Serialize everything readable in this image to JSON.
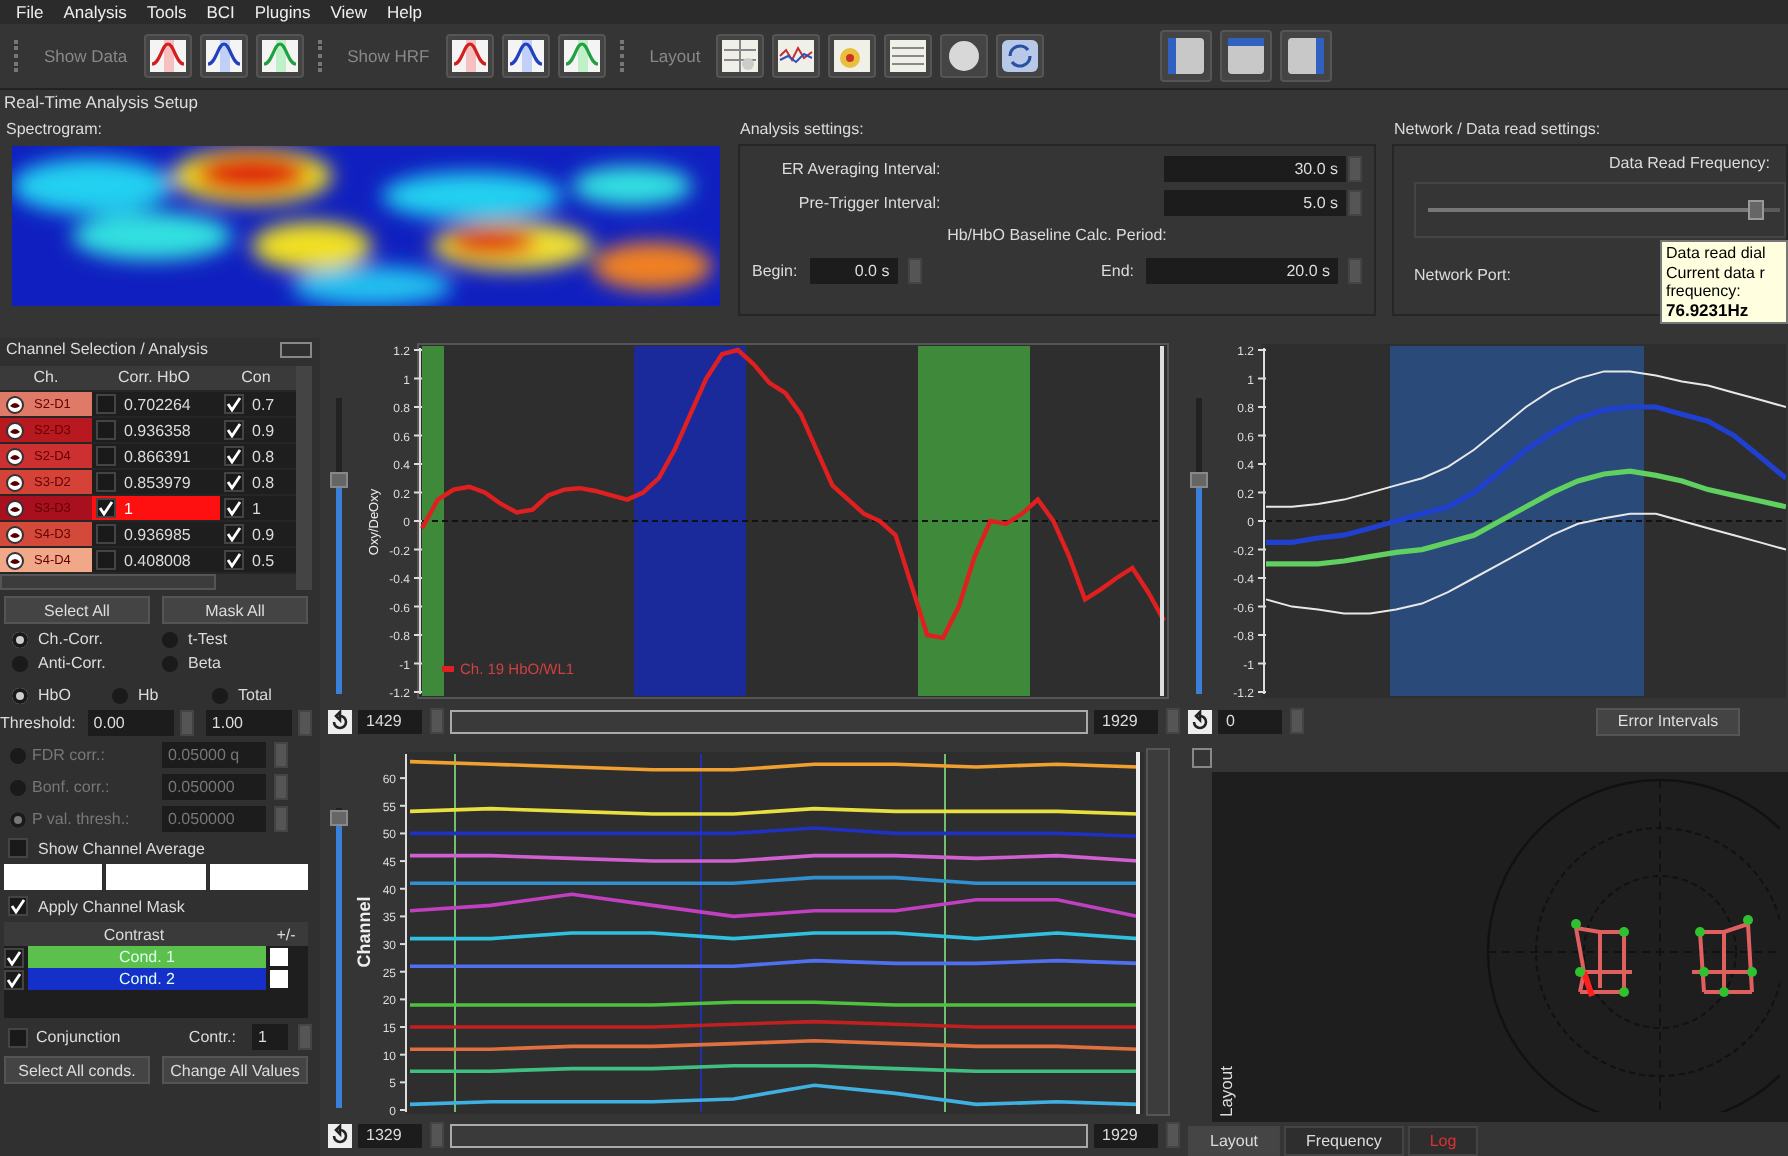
{
  "menu": [
    "File",
    "Analysis",
    "Tools",
    "BCI",
    "Plugins",
    "View",
    "Help"
  ],
  "toolbar": {
    "groups": [
      {
        "label": "Show Data"
      },
      {
        "label": "Show HRF"
      },
      {
        "label": "Layout"
      }
    ]
  },
  "title": "Real-Time Analysis Setup",
  "spectrogram": {
    "title": "Spectrogram:"
  },
  "analysis_settings": {
    "title": "Analysis settings:",
    "er_averaging": {
      "label": "ER Averaging Interval:",
      "value": "30.0 s"
    },
    "pre_trigger": {
      "label": "Pre-Trigger Interval:",
      "value": "5.0 s"
    },
    "baseline_title": "Hb/HbO Baseline Calc. Period:",
    "begin": {
      "label": "Begin:",
      "value": "0.0 s"
    },
    "end": {
      "label": "End:",
      "value": "20.0 s"
    }
  },
  "network": {
    "title": "Network / Data read settings:",
    "frequency_label": "Data Read Frequency:",
    "frequency_slider": {
      "level": 0.93
    },
    "port_label": "Network Port:",
    "tooltip": {
      "lines": [
        "Data read dial",
        "Current data r",
        "frequency:"
      ],
      "value": "76.9231Hz"
    }
  },
  "channel_panel": {
    "title": "Channel Selection / Analysis",
    "columns": [
      "Ch.",
      "Corr. HbO",
      "Con"
    ],
    "rows": [
      {
        "channel": "S2-D1",
        "color": "#e07a68",
        "checked": false,
        "corr": "0.702264",
        "con_checked": true,
        "con": "0.7",
        "selected": false
      },
      {
        "channel": "S2-D3",
        "color": "#b81820",
        "checked": false,
        "corr": "0.936358",
        "con_checked": true,
        "con": "0.9",
        "selected": false
      },
      {
        "channel": "S2-D4",
        "color": "#cc3030",
        "checked": false,
        "corr": "0.866391",
        "con_checked": true,
        "con": "0.8",
        "selected": false
      },
      {
        "channel": "S3-D2",
        "color": "#d44238",
        "checked": false,
        "corr": "0.853979",
        "con_checked": true,
        "con": "0.8",
        "selected": false
      },
      {
        "channel": "S3-D3",
        "color": "#a81020",
        "checked": true,
        "corr": "1",
        "con_checked": true,
        "con": "1",
        "selected": true
      },
      {
        "channel": "S4-D3",
        "color": "#d44a3a",
        "checked": false,
        "corr": "0.936985",
        "con_checked": true,
        "con": "0.9",
        "selected": false
      },
      {
        "channel": "S4-D4",
        "color": "#f0a888",
        "checked": false,
        "corr": "0.408008",
        "con_checked": true,
        "con": "0.5",
        "selected": false
      }
    ],
    "buttons": [
      "Select All",
      "Mask All"
    ],
    "method_options": [
      {
        "label": "Ch.-Corr.",
        "selected": true
      },
      {
        "label": "t-Test",
        "selected": false
      },
      {
        "label": "Anti-Corr.",
        "selected": false
      },
      {
        "label": "Beta",
        "selected": false
      }
    ],
    "signal_options": [
      {
        "label": "HbO",
        "selected": true
      },
      {
        "label": "Hb",
        "selected": false
      },
      {
        "label": "Total",
        "selected": false
      }
    ],
    "threshold": {
      "label": "Threshold:",
      "min": "0.00",
      "max": "1.00"
    },
    "corrections": [
      {
        "label": "FDR corr.:",
        "value": "0.05000 q",
        "selected": false,
        "disabled": true
      },
      {
        "label": "Bonf. corr.:",
        "value": "0.050000",
        "selected": false,
        "disabled": true
      },
      {
        "label": "P val. thresh.:",
        "value": "0.050000",
        "selected": true,
        "disabled": true
      }
    ],
    "show_channel_average": {
      "label": "Show Channel Average",
      "checked": false
    },
    "apply_channel_mask": {
      "label": "Apply Channel Mask",
      "checked": true
    },
    "contrast_table": {
      "columns": [
        "Contrast",
        "+/-"
      ],
      "rows": [
        {
          "label": "Cond. 1",
          "color": "#5cc04c",
          "checked": true
        },
        {
          "label": "Cond. 2",
          "color": "#1530c8",
          "checked": true
        }
      ]
    },
    "conjunction": {
      "label": "Conjunction",
      "checked": false
    },
    "contrast_spin": {
      "label": "Contr.:",
      "value": "1"
    },
    "bottom_buttons": [
      "Select All conds.",
      "Change All Values"
    ]
  },
  "signal_chart": {
    "slider": {
      "level": 0.72
    },
    "range_start": "1429",
    "range_end": "1929",
    "chart_data": {
      "type": "line",
      "ylabel": "Oxy/DeOxy",
      "ylim": [
        -1.2,
        1.2
      ],
      "yticks": [
        -1.2,
        -1,
        -0.8,
        -0.6,
        -0.4,
        -0.2,
        0,
        0.2,
        0.4,
        0.6,
        0.8,
        1,
        1.2
      ],
      "series": [
        {
          "name": "Ch. 19 HbO/WL1",
          "color": "#e02020",
          "values": [
            -0.05,
            0.15,
            0.22,
            0.24,
            0.2,
            0.12,
            0.06,
            0.08,
            0.18,
            0.22,
            0.23,
            0.21,
            0.18,
            0.15,
            0.2,
            0.3,
            0.5,
            0.75,
            1.0,
            1.17,
            1.2,
            1.1,
            0.97,
            0.9,
            0.75,
            0.5,
            0.25,
            0.15,
            0.05,
            0.0,
            -0.1,
            -0.45,
            -0.8,
            -0.82,
            -0.6,
            -0.25,
            0.0,
            -0.02,
            0.05,
            0.15,
            0.0,
            -0.25,
            -0.55,
            -0.48,
            -0.4,
            -0.33,
            -0.5,
            -0.7
          ]
        }
      ],
      "ref_lines": [
        {
          "axis": "y",
          "value": 0
        }
      ]
    }
  },
  "hrf_chart": {
    "slider": {
      "level": 0.72
    },
    "range_start": "0",
    "button": "Error Intervals",
    "chart_data": {
      "type": "line",
      "ylim": [
        -1.2,
        1.2
      ],
      "yticks": [
        -1.2,
        -1,
        -0.8,
        -0.6,
        -0.4,
        -0.2,
        0,
        0.2,
        0.4,
        0.6,
        0.8,
        1,
        1.2
      ],
      "series": [
        {
          "color": "#2040d0",
          "values": [
            -0.15,
            -0.15,
            -0.12,
            -0.1,
            -0.05,
            0.0,
            0.05,
            0.1,
            0.2,
            0.35,
            0.5,
            0.62,
            0.72,
            0.78,
            0.8,
            0.8,
            0.75,
            0.7,
            0.6,
            0.45,
            0.3
          ]
        },
        {
          "color": "#60d060",
          "values": [
            -0.3,
            -0.3,
            -0.3,
            -0.28,
            -0.25,
            -0.22,
            -0.2,
            -0.15,
            -0.1,
            0.0,
            0.1,
            0.2,
            0.28,
            0.33,
            0.35,
            0.32,
            0.28,
            0.22,
            0.18,
            0.14,
            0.1
          ]
        },
        {
          "color": "#e8e8e8",
          "values": [
            0.1,
            0.1,
            0.12,
            0.15,
            0.2,
            0.25,
            0.3,
            0.38,
            0.5,
            0.65,
            0.8,
            0.92,
            1.0,
            1.05,
            1.05,
            1.02,
            0.98,
            0.95,
            0.9,
            0.85,
            0.8
          ]
        },
        {
          "color": "#e8e8e8",
          "values": [
            -0.55,
            -0.6,
            -0.62,
            -0.65,
            -0.65,
            -0.62,
            -0.58,
            -0.5,
            -0.4,
            -0.3,
            -0.2,
            -0.1,
            -0.02,
            0.02,
            0.05,
            0.05,
            0.0,
            -0.05,
            -0.1,
            -0.15,
            -0.2
          ]
        }
      ],
      "ref_lines": [
        {
          "axis": "y",
          "value": 0
        }
      ]
    }
  },
  "channel_chart": {
    "slider": {
      "level": 0.97
    },
    "range_start": "1329",
    "range_end": "1929",
    "ylabel": "Channel",
    "yticks": [
      "60",
      "55",
      "50",
      "45",
      "40",
      "35",
      "30",
      "25",
      "20",
      "15",
      "10",
      "5",
      "0"
    ]
  },
  "layout_panel": {
    "label": "Layout",
    "tabs": [
      {
        "label": "Layout",
        "selected": true
      },
      {
        "label": "Frequency",
        "selected": false
      },
      {
        "label": "Log",
        "selected": false
      }
    ]
  }
}
